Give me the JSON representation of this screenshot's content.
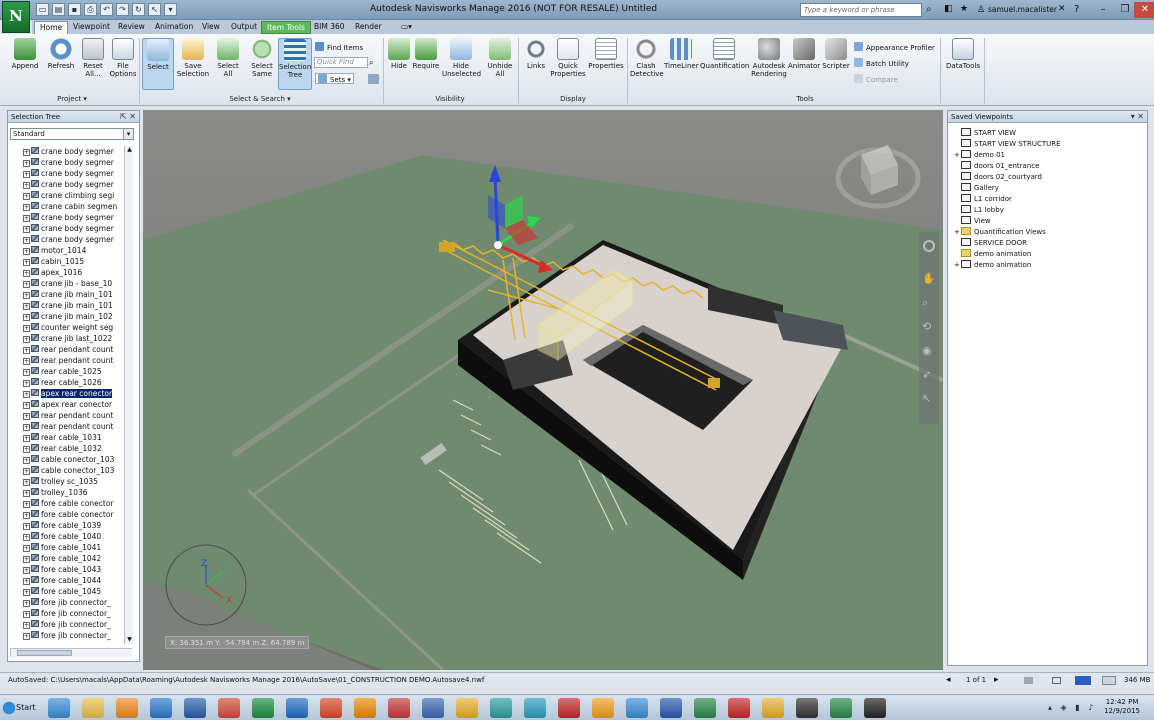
{
  "app": {
    "logo_letter": "N",
    "title": "Autodesk Navisworks Manage 2016 (NOT FOR RESALE)   Untitled",
    "search_placeholder": "Type a keyword or phrase",
    "user": "samuel.macalister",
    "window_controls": [
      "–",
      "❐",
      "✕"
    ]
  },
  "tabs": [
    "Home",
    "Viewpoint",
    "Review",
    "Animation",
    "View",
    "Output",
    "Item Tools",
    "BIM 360",
    "Render"
  ],
  "ribbon": {
    "project": {
      "label": "Project ▾",
      "buttons": [
        "Append",
        "Refresh",
        "Reset All...",
        "File Options"
      ]
    },
    "select_search": {
      "label": "Select & Search ▾",
      "buttons": [
        "Select",
        "Save Selection",
        "Select All",
        "Select Same",
        "Selection Tree"
      ],
      "find_items": "Find Items",
      "quick_find_placeholder": "Quick Find",
      "sets": "Sets"
    },
    "visibility": {
      "label": "Visibility",
      "buttons": [
        "Hide",
        "Require",
        "Hide Unselected",
        "Unhide All"
      ]
    },
    "display": {
      "label": "Display",
      "buttons": [
        "Links",
        "Quick Properties",
        "Properties"
      ]
    },
    "tools": {
      "label": "Tools",
      "buttons": [
        "Clash Detective",
        "TimeLiner",
        "Quantification",
        "Autodesk Rendering",
        "Animator",
        "Scripter"
      ],
      "small": [
        "Appearance Profiler",
        "Batch Utility",
        "Compare"
      ]
    },
    "datatools": "DataTools"
  },
  "selection_tree": {
    "title": "Selection Tree",
    "dropdown_value": "Standard",
    "items": [
      "crane body segmer",
      "crane body segmer",
      "crane body segmer",
      "crane body segmer",
      "crane climbing segi",
      "crane cabin segmen",
      "crane body segmer",
      "crane body segmer",
      "crane body segmer",
      "motor_1014",
      "cabin_1015",
      "apex_1016",
      "crane jib - base_10",
      "crane jib main_101",
      "crane jib main_101",
      "crane jib main_102",
      "counter weight seg",
      "crane jib last_1022",
      "rear pendant count",
      "rear pendant count",
      "rear cable_1025",
      "rear cable_1026",
      "apex rear conector",
      "apex rear conector",
      "rear pendant count",
      "rear pendant count",
      "rear cable_1031",
      "rear cable_1032",
      "cable conector_103",
      "cable conector_103",
      "trolley sc_1035",
      "trolley_1036",
      "fore cable conector",
      "fore cable conector",
      "fore cable_1039",
      "fore cable_1040",
      "fore cable_1041",
      "fore cable_1042",
      "fore cable_1043",
      "fore cable_1044",
      "fore cable_1045",
      "fore jib connector_",
      "fore jib connector_",
      "fore jib connector_",
      "fore jib connector_"
    ],
    "selected_index": 22
  },
  "saved_viewpoints": {
    "title": "Saved Viewpoints",
    "items": [
      {
        "label": "START VIEW",
        "kind": "camera",
        "expand": false
      },
      {
        "label": "START VIEW STRUCTURE",
        "kind": "camera",
        "expand": false
      },
      {
        "label": "demo 01",
        "kind": "camera",
        "expand": true
      },
      {
        "label": "doors 01_entrance",
        "kind": "camera",
        "expand": false
      },
      {
        "label": "doors 02_courtyard",
        "kind": "camera",
        "expand": false
      },
      {
        "label": "Gallery",
        "kind": "camera",
        "expand": false
      },
      {
        "label": "L1 corridor",
        "kind": "camera",
        "expand": false
      },
      {
        "label": "L1 lobby",
        "kind": "camera",
        "expand": false
      },
      {
        "label": "View",
        "kind": "camera",
        "expand": false
      },
      {
        "label": "Quantification Views",
        "kind": "folder",
        "expand": true
      },
      {
        "label": "SERVICE DOOR",
        "kind": "camera",
        "expand": false
      },
      {
        "label": "demo animation",
        "kind": "folder",
        "expand": false
      },
      {
        "label": "demo animation",
        "kind": "camera",
        "expand": true
      }
    ]
  },
  "viewport": {
    "coords": "X: 36.351 m  Y: -54.784 m  Z: 64.789 m",
    "axis_labels": [
      "Z",
      "Y",
      "X"
    ]
  },
  "status": {
    "autosave": "AutoSaved: C:\\Users\\macals\\AppData\\Roaming\\Autodesk Navisworks Manage 2016\\AutoSave\\01_CONSTRUCTION DEMO.Autosave4.nwf",
    "page": "1 of 1",
    "memory": "346 MB"
  },
  "taskbar": {
    "start": "Start",
    "time": "12:42 PM",
    "date": "12/9/2015"
  },
  "colors": {
    "ribbon_ctx_tab": "#5cb85c",
    "selection": "#0a246a",
    "ground": "#6f8a6e",
    "crane": "#e6b32a"
  }
}
